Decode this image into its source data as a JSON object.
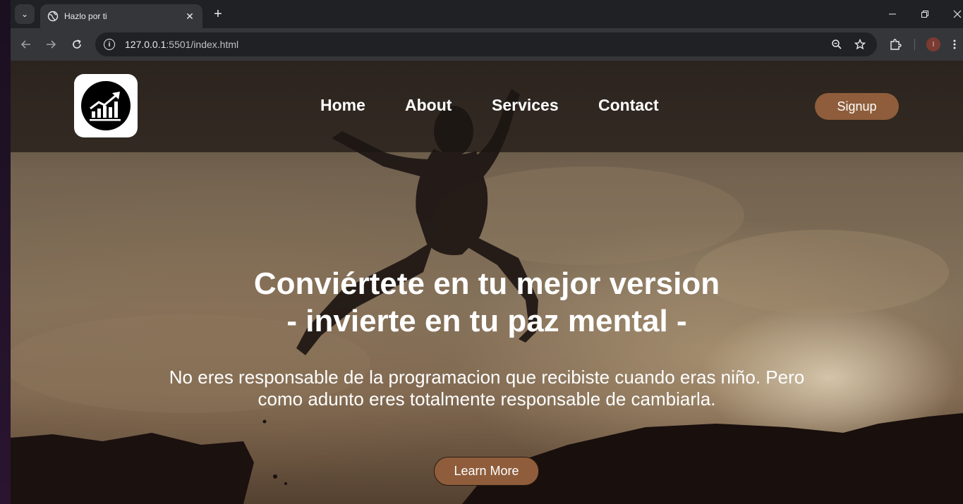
{
  "browser": {
    "tab_title": "Hazlo por ti",
    "tab_close": "✕",
    "new_tab": "+",
    "url_host": "127.0.0.1",
    "url_rest": ":5501/index.html",
    "profile_initial": "I"
  },
  "site": {
    "nav": {
      "home": "Home",
      "about": "About",
      "services": "Services",
      "contact": "Contact",
      "signup": "Signup"
    },
    "hero": {
      "title_line1": "Conviértete en tu mejor version",
      "title_line2": "- invierte en tu paz mental -",
      "text_line1": "No eres responsable de la programacion que recibiste cuando eras niño. Pero",
      "text_line2": "como adunto eres totalmente responsable de cambiarla.",
      "cta": "Learn More"
    },
    "colors": {
      "accent": "#8f5d3b",
      "navbar": "#1c1614",
      "text": "#ffffff"
    }
  }
}
